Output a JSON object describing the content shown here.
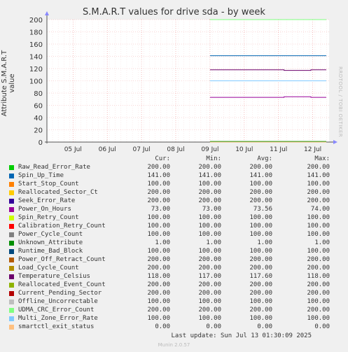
{
  "vendor": "RRDTOOL / TOBI OETIKER",
  "footer": {
    "last_update": "Last update: Sun Jul 13 01:30:09 2025",
    "munin": "Munin 2.0.57"
  },
  "legend_headers": [
    "Cur:",
    "Min:",
    "Avg:",
    "Max:"
  ],
  "chart_data": {
    "type": "line",
    "title": "S.M.A.R.T values for drive sda - by week",
    "ylabel": "Attribute S.M.A.R.T value",
    "xlabel": "",
    "x_ticks": [
      "05 Jul",
      "06 Jul",
      "07 Jul",
      "08 Jul",
      "09 Jul",
      "10 Jul",
      "11 Jul",
      "12 Jul"
    ],
    "y_ticks": [
      0,
      20,
      40,
      60,
      80,
      100,
      120,
      140,
      160,
      180,
      200
    ],
    "ylim": [
      0,
      200
    ],
    "grid": true,
    "data_start": "09 Jul",
    "series": [
      {
        "name": "Raw_Read_Error_Rate",
        "color": "#00cc00",
        "cur": "200.00",
        "min": "200.00",
        "avg": "200.00",
        "max": "200.00",
        "value": 200
      },
      {
        "name": "Spin_Up_Time",
        "color": "#0066b3",
        "cur": "141.00",
        "min": "141.00",
        "avg": "141.00",
        "max": "141.00",
        "value": 141
      },
      {
        "name": "Start_Stop_Count",
        "color": "#ff8000",
        "cur": "100.00",
        "min": "100.00",
        "avg": "100.00",
        "max": "100.00",
        "value": 100
      },
      {
        "name": "Reallocated_Sector_Ct",
        "color": "#ffcc00",
        "cur": "200.00",
        "min": "200.00",
        "avg": "200.00",
        "max": "200.00",
        "value": 200
      },
      {
        "name": "Seek_Error_Rate",
        "color": "#330099",
        "cur": "200.00",
        "min": "200.00",
        "avg": "200.00",
        "max": "200.00",
        "value": 200
      },
      {
        "name": "Power_On_Hours",
        "color": "#990099",
        "cur": "73.00",
        "min": "73.00",
        "avg": "73.56",
        "max": "74.00",
        "value": 73,
        "step": 74
      },
      {
        "name": "Spin_Retry_Count",
        "color": "#ccff00",
        "cur": "100.00",
        "min": "100.00",
        "avg": "100.00",
        "max": "100.00",
        "value": 100
      },
      {
        "name": "Calibration_Retry_Count",
        "color": "#ff0000",
        "cur": "100.00",
        "min": "100.00",
        "avg": "100.00",
        "max": "100.00",
        "value": 100
      },
      {
        "name": "Power_Cycle_Count",
        "color": "#808080",
        "cur": "100.00",
        "min": "100.00",
        "avg": "100.00",
        "max": "100.00",
        "value": 100
      },
      {
        "name": "Unknown_Attribute",
        "color": "#008f00",
        "cur": "1.00",
        "min": "1.00",
        "avg": "1.00",
        "max": "1.00",
        "value": 1
      },
      {
        "name": "Runtime_Bad_Block",
        "color": "#00487d",
        "cur": "100.00",
        "min": "100.00",
        "avg": "100.00",
        "max": "100.00",
        "value": 100
      },
      {
        "name": "Power_Off_Retract_Count",
        "color": "#b35a00",
        "cur": "200.00",
        "min": "200.00",
        "avg": "200.00",
        "max": "200.00",
        "value": 200
      },
      {
        "name": "Load_Cycle_Count",
        "color": "#b38f00",
        "cur": "200.00",
        "min": "200.00",
        "avg": "200.00",
        "max": "200.00",
        "value": 200
      },
      {
        "name": "Temperature_Celsius",
        "color": "#6b006b",
        "cur": "118.00",
        "min": "117.00",
        "avg": "117.60",
        "max": "118.00",
        "value": 118,
        "step": 117
      },
      {
        "name": "Reallocated_Event_Count",
        "color": "#8fb300",
        "cur": "200.00",
        "min": "200.00",
        "avg": "200.00",
        "max": "200.00",
        "value": 200
      },
      {
        "name": "Current_Pending_Sector",
        "color": "#b30000",
        "cur": "200.00",
        "min": "200.00",
        "avg": "200.00",
        "max": "200.00",
        "value": 200
      },
      {
        "name": "Offline_Uncorrectable",
        "color": "#bebebe",
        "cur": "100.00",
        "min": "100.00",
        "avg": "100.00",
        "max": "100.00",
        "value": 100
      },
      {
        "name": "UDMA_CRC_Error_Count",
        "color": "#80ff80",
        "cur": "200.00",
        "min": "200.00",
        "avg": "200.00",
        "max": "200.00",
        "value": 200
      },
      {
        "name": "Multi_Zone_Error_Rate",
        "color": "#80c9ff",
        "cur": "100.00",
        "min": "100.00",
        "avg": "100.00",
        "max": "100.00",
        "value": 100
      },
      {
        "name": "smartctl_exit_status",
        "color": "#ffc080",
        "cur": "0.00",
        "min": "0.00",
        "avg": "0.00",
        "max": "0.00",
        "value": 0
      }
    ]
  }
}
